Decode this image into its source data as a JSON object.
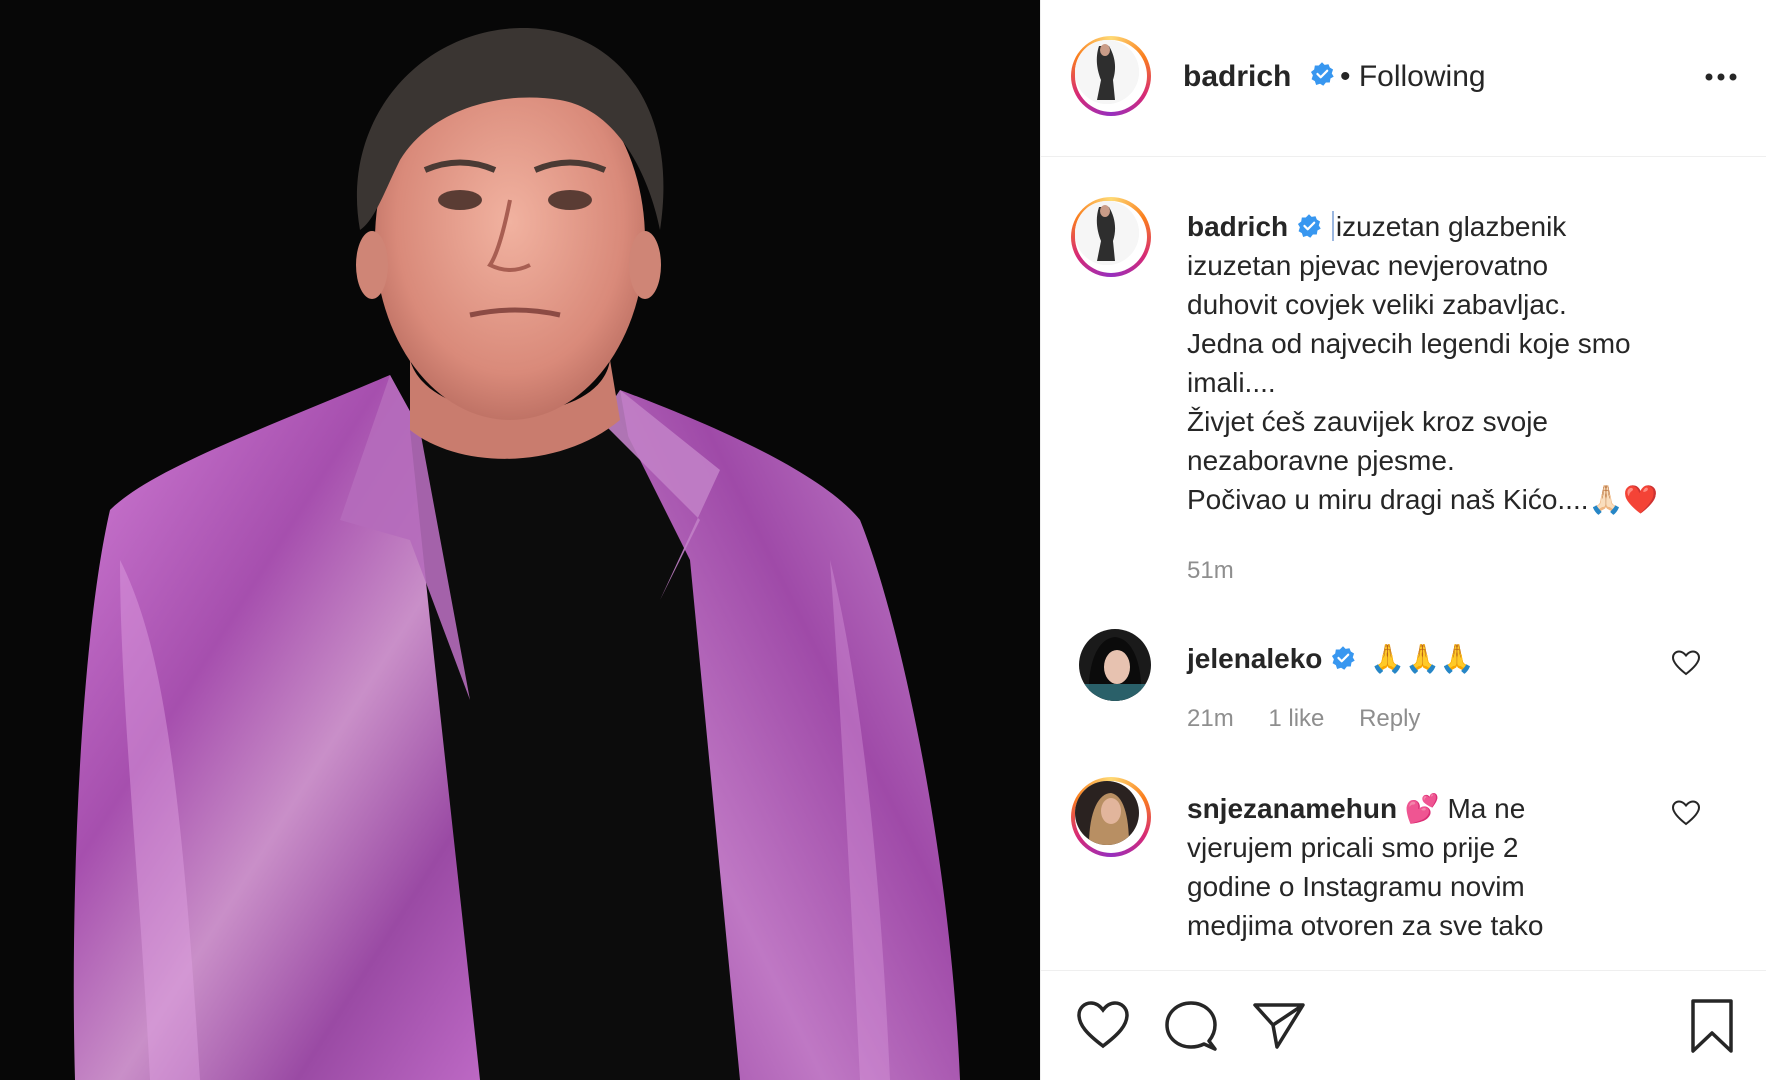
{
  "post": {
    "author": "badrich",
    "follow_state": "• Following",
    "more_icon": "more-horizontal-icon"
  },
  "caption": {
    "username": "badrich",
    "lines": [
      "izuzetan glazbenik",
      "izuzetan pjevac nevjerovatno",
      "duhovit covjek veliki zabavljac.",
      "Jedna od najvecih legendi koje smo",
      "imali....",
      "Živjet ćeš zauvijek kroz svoje",
      "nezaboravne pjesme.",
      "Počivao u miru dragi naš Kićo....🙏🏻❤️"
    ],
    "time": "51m"
  },
  "comments": [
    {
      "username": "jelenaleko",
      "verified": true,
      "text": "🙏🙏🙏",
      "time": "21m",
      "likes": "1 like",
      "reply": "Reply"
    },
    {
      "username": "snjezanamehun",
      "verified": false,
      "text_lines": [
        "💕 Ma ne",
        "vjerujem pricali smo prije 2",
        "godine o Instagramu novim",
        "medjima otvoren za sve tako"
      ]
    }
  ],
  "colors": {
    "verified_blue": "#3897f0",
    "text": "#262626",
    "meta_gray": "#8e8e8e",
    "photo_bg": "#070707",
    "jacket_pink": "#b25ab9"
  }
}
